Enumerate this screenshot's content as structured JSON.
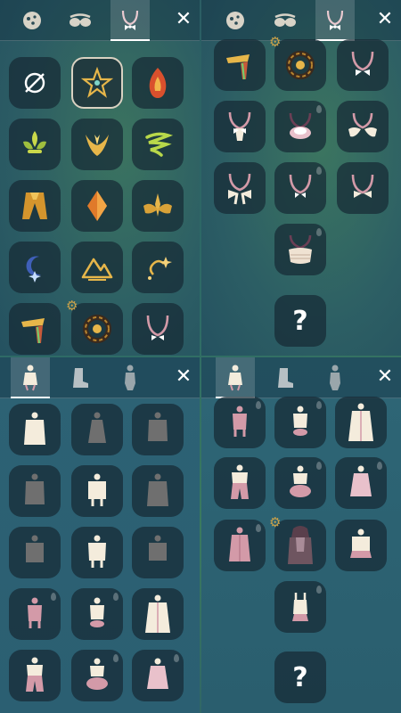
{
  "colors": {
    "panel_bg": "#2c5f68",
    "cell_bg": "#162a34",
    "gold": "#e6b64a",
    "cape_cream": "#f4ecdc",
    "cape_gray": "#6f6f6f",
    "rose": "#d39aa8",
    "strap": "#6b3f55",
    "close": "#ffffff"
  },
  "panels": {
    "top_left": {
      "tabs": [
        {
          "icon": "face-icon",
          "active": false
        },
        {
          "icon": "glasses-icon",
          "active": false
        },
        {
          "icon": "neckwear-icon",
          "active": true
        }
      ],
      "close_label": "✕",
      "items": [
        {
          "icon": "none-icon",
          "selected": false
        },
        {
          "icon": "star-emblem-icon",
          "selected": true
        },
        {
          "icon": "fire-emblem-icon",
          "selected": false
        },
        {
          "icon": "fleur-emblem-icon",
          "selected": false
        },
        {
          "icon": "wing-emblem-icon",
          "selected": false
        },
        {
          "icon": "swirl-emblem-icon",
          "selected": false
        },
        {
          "icon": "cape-emblem-icon",
          "selected": false
        },
        {
          "icon": "crystal-emblem-icon",
          "selected": false
        },
        {
          "icon": "bloom-emblem-icon",
          "selected": false
        },
        {
          "icon": "moon-emblem-icon",
          "selected": false
        },
        {
          "icon": "mountain-emblem-icon",
          "selected": false
        },
        {
          "icon": "spark-emblem-icon",
          "selected": false
        },
        {
          "icon": "prism-emblem-icon",
          "selected": false
        },
        {
          "icon": "gear-emblem-icon",
          "selected": false,
          "gear": true
        },
        {
          "icon": "necklace-icon",
          "selected": false
        }
      ]
    },
    "top_right": {
      "tabs": [
        {
          "icon": "face-icon",
          "active": false
        },
        {
          "icon": "glasses-icon",
          "active": false
        },
        {
          "icon": "neckwear-icon",
          "active": true
        }
      ],
      "close_label": "✕",
      "items": [
        {
          "icon": "prism-emblem-icon"
        },
        {
          "icon": "gear-emblem-icon",
          "gear": true
        },
        {
          "icon": "bow-necklace-icon"
        },
        {
          "icon": "scarf-necklace-icon"
        },
        {
          "icon": "ruffle-necklace-icon",
          "drop": true
        },
        {
          "icon": "collar-necklace-icon"
        },
        {
          "icon": "big-bow-necklace-icon"
        },
        {
          "icon": "small-bow-necklace-icon",
          "drop": true
        },
        {
          "icon": "bow-tie-necklace-icon"
        },
        {
          "icon": "knit-scarf-icon",
          "drop": true
        },
        {
          "icon": "question-icon",
          "label": "?"
        }
      ]
    },
    "bottom_left": {
      "tabs": [
        {
          "icon": "outfit-icon",
          "active": true
        },
        {
          "icon": "boots-icon",
          "active": false
        },
        {
          "icon": "body-icon",
          "active": false
        }
      ],
      "close_label": "✕",
      "items": [
        {
          "icon": "cream-robe-icon"
        },
        {
          "icon": "gray-dress-icon"
        },
        {
          "icon": "gray-coat-icon"
        },
        {
          "icon": "gray-robe-icon"
        },
        {
          "icon": "cream-tunic-icon"
        },
        {
          "icon": "gray-long-coat-icon"
        },
        {
          "icon": "gray-short-robe-icon"
        },
        {
          "icon": "cream-shirt-icon"
        },
        {
          "icon": "gray-jacket-icon"
        },
        {
          "icon": "pink-suit-icon",
          "drop": true
        },
        {
          "icon": "cream-romper-icon",
          "drop": true
        },
        {
          "icon": "long-cloak-icon"
        },
        {
          "icon": "pants-outfit-icon"
        },
        {
          "icon": "bloomers-outfit-icon",
          "drop": true
        },
        {
          "icon": "pink-dress-icon",
          "drop": true
        }
      ]
    },
    "bottom_right": {
      "tabs": [
        {
          "icon": "outfit-icon",
          "active": true
        },
        {
          "icon": "boots-icon",
          "active": false
        },
        {
          "icon": "body-icon",
          "active": false
        }
      ],
      "close_label": "✕",
      "items": [
        {
          "icon": "pink-suit-icon",
          "drop": true
        },
        {
          "icon": "cream-romper-icon",
          "drop": true
        },
        {
          "icon": "long-cloak-icon"
        },
        {
          "icon": "pants-outfit-icon"
        },
        {
          "icon": "bloomers-outfit-icon",
          "drop": true
        },
        {
          "icon": "pink-dress-icon",
          "drop": true
        },
        {
          "icon": "pink-coat-icon",
          "drop": true
        },
        {
          "icon": "hooded-cape-icon",
          "gear": true
        },
        {
          "icon": "cream-skirt-outfit-icon"
        },
        {
          "icon": "overalls-icon",
          "drop": true
        },
        {
          "icon": "question-icon",
          "label": "?"
        }
      ]
    }
  }
}
